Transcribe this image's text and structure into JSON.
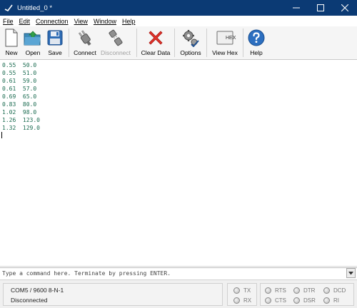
{
  "window": {
    "title": "Untitled_0 *"
  },
  "menu": [
    "File",
    "Edit",
    "Connection",
    "View",
    "Window",
    "Help"
  ],
  "toolbar": {
    "new": "New",
    "open": "Open",
    "save": "Save",
    "connect": "Connect",
    "disconnect": "Disconnect",
    "clear": "Clear Data",
    "options": "Options",
    "viewhex": "View Hex",
    "help": "Help",
    "hex_icon_text": "HEX"
  },
  "terminal_lines": [
    "0.55  50.0",
    "0.55  51.0",
    "0.61  59.0",
    "0.61  57.0",
    "0.69  65.0",
    "0.83  80.0",
    "1.02  98.0",
    "1.26  123.0",
    "1.32  129.0"
  ],
  "command": {
    "placeholder": "Type a command here. Terminate by pressing ENTER."
  },
  "status": {
    "port": "COM5 / 9600 8-N-1",
    "connection": "Disconnected"
  },
  "signals": {
    "tx": "TX",
    "rx": "RX",
    "rts": "RTS",
    "cts": "CTS",
    "dtr": "DTR",
    "dsr": "DSR",
    "dcd": "DCD",
    "ri": "RI"
  }
}
